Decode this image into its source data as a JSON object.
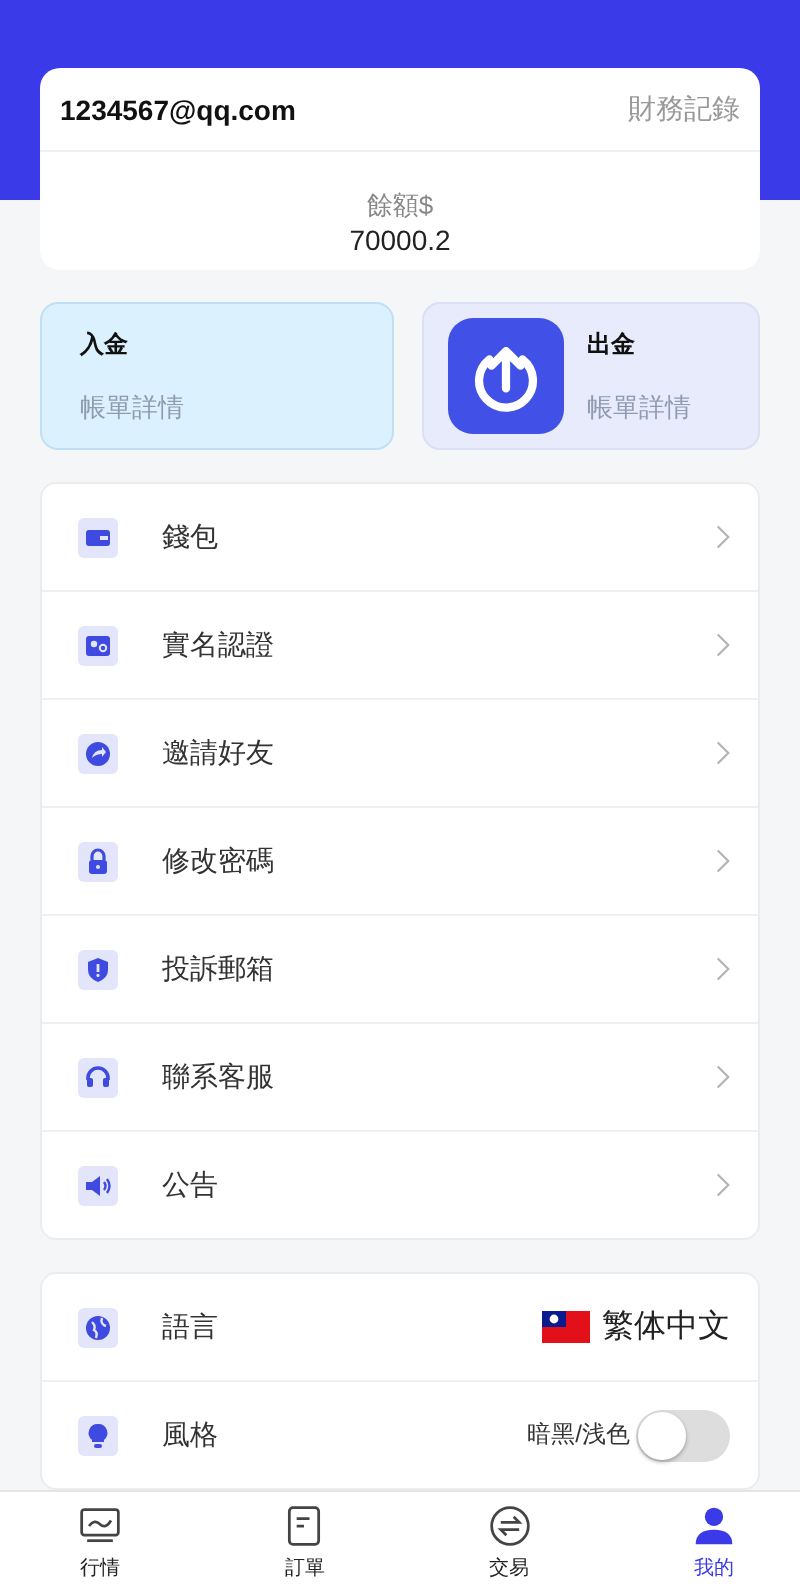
{
  "account": {
    "email": "1234567@qq.com",
    "records_link": "財務記錄",
    "balance_label": "餘額$",
    "balance": "70000.2"
  },
  "fund_cards": [
    {
      "kind": "deposit",
      "title": "入金",
      "subtitle": "帳單詳情"
    },
    {
      "kind": "withdraw",
      "title": "出金",
      "subtitle": "帳單詳情"
    }
  ],
  "menu": [
    {
      "kind": "wallet",
      "label": "錢包"
    },
    {
      "kind": "id",
      "label": "實名認證"
    },
    {
      "kind": "share",
      "label": "邀請好友"
    },
    {
      "kind": "lock",
      "label": "修改密碼"
    },
    {
      "kind": "shield",
      "label": "投訴郵箱"
    },
    {
      "kind": "headset",
      "label": "聯系客服"
    },
    {
      "kind": "speaker",
      "label": "公告"
    }
  ],
  "settings": [
    {
      "kind": "language",
      "label": "語言",
      "value": "繁体中文"
    },
    {
      "kind": "theme",
      "label": "風格",
      "value": "暗黑/浅色",
      "on": false
    }
  ],
  "tabs": [
    {
      "kind": "chart",
      "label": "行情",
      "selected": false
    },
    {
      "kind": "doc",
      "label": "訂單",
      "selected": false
    },
    {
      "kind": "swap",
      "label": "交易",
      "selected": false
    },
    {
      "kind": "user",
      "label": "我的",
      "selected": true
    }
  ]
}
